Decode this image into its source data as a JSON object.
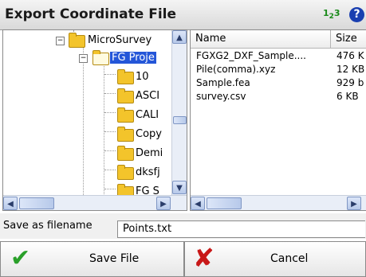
{
  "window": {
    "title": "Export Coordinate File",
    "input_mode_main": "1",
    "input_mode_sub1": "2",
    "input_mode_sub2": "3",
    "help_label": "?"
  },
  "tree": {
    "items": [
      {
        "label": "MicroSurvey",
        "expanded": true
      },
      {
        "label": "FG Proje",
        "expanded": true,
        "selected": true
      },
      {
        "label": "10"
      },
      {
        "label": "ASCI"
      },
      {
        "label": "CALI"
      },
      {
        "label": "Copy"
      },
      {
        "label": "Demi"
      },
      {
        "label": "dksfj"
      },
      {
        "label": "FG S"
      }
    ]
  },
  "files": {
    "columns": [
      "Name",
      "Size"
    ],
    "rows": [
      {
        "name": "FGXG2_DXF_Sample....",
        "size": "476 K"
      },
      {
        "name": "Pile(comma).xyz",
        "size": "12 KB"
      },
      {
        "name": "Sample.fea",
        "size": "929 b"
      },
      {
        "name": "survey.csv",
        "size": "6 KB"
      }
    ]
  },
  "save": {
    "label": "Save as filename",
    "value": "Points.txt"
  },
  "buttons": {
    "save": "Save File",
    "cancel": "Cancel"
  },
  "colors": {
    "selection": "#2456d8",
    "folder": "#f3c42b",
    "check": "#2aa02a",
    "cancel_x": "#c81818"
  }
}
